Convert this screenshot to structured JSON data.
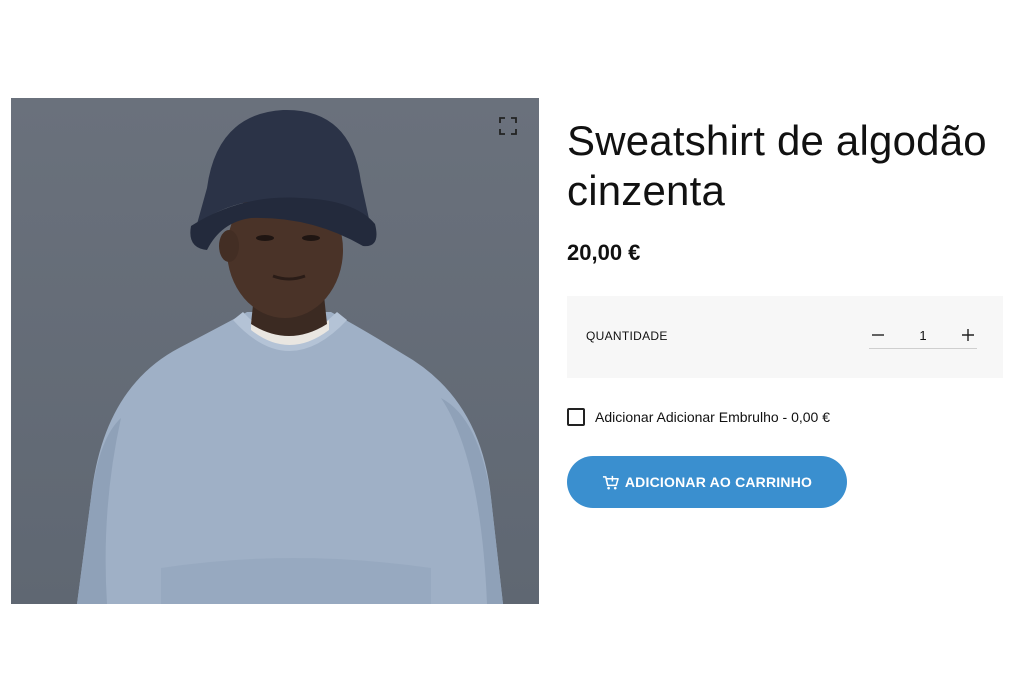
{
  "product": {
    "title": "Sweatshirt de algodão cinzenta",
    "price": "20,00 €",
    "image_icon": "zoom-expand-icon"
  },
  "quantity": {
    "label": "QUANTIDADE",
    "value": "1",
    "decrease_icon": "minus-icon",
    "increase_icon": "plus-icon"
  },
  "gift_wrap": {
    "label": "Adicionar Adicionar Embrulho - 0,00 €",
    "checked": false
  },
  "cart_button": {
    "label": "ADICIONAR AO CARRINHO",
    "icon": "cart-plus-icon",
    "color": "#3a8fcf"
  },
  "colors": {
    "image_background": "#656c77",
    "quantity_panel": "#f7f7f7"
  }
}
